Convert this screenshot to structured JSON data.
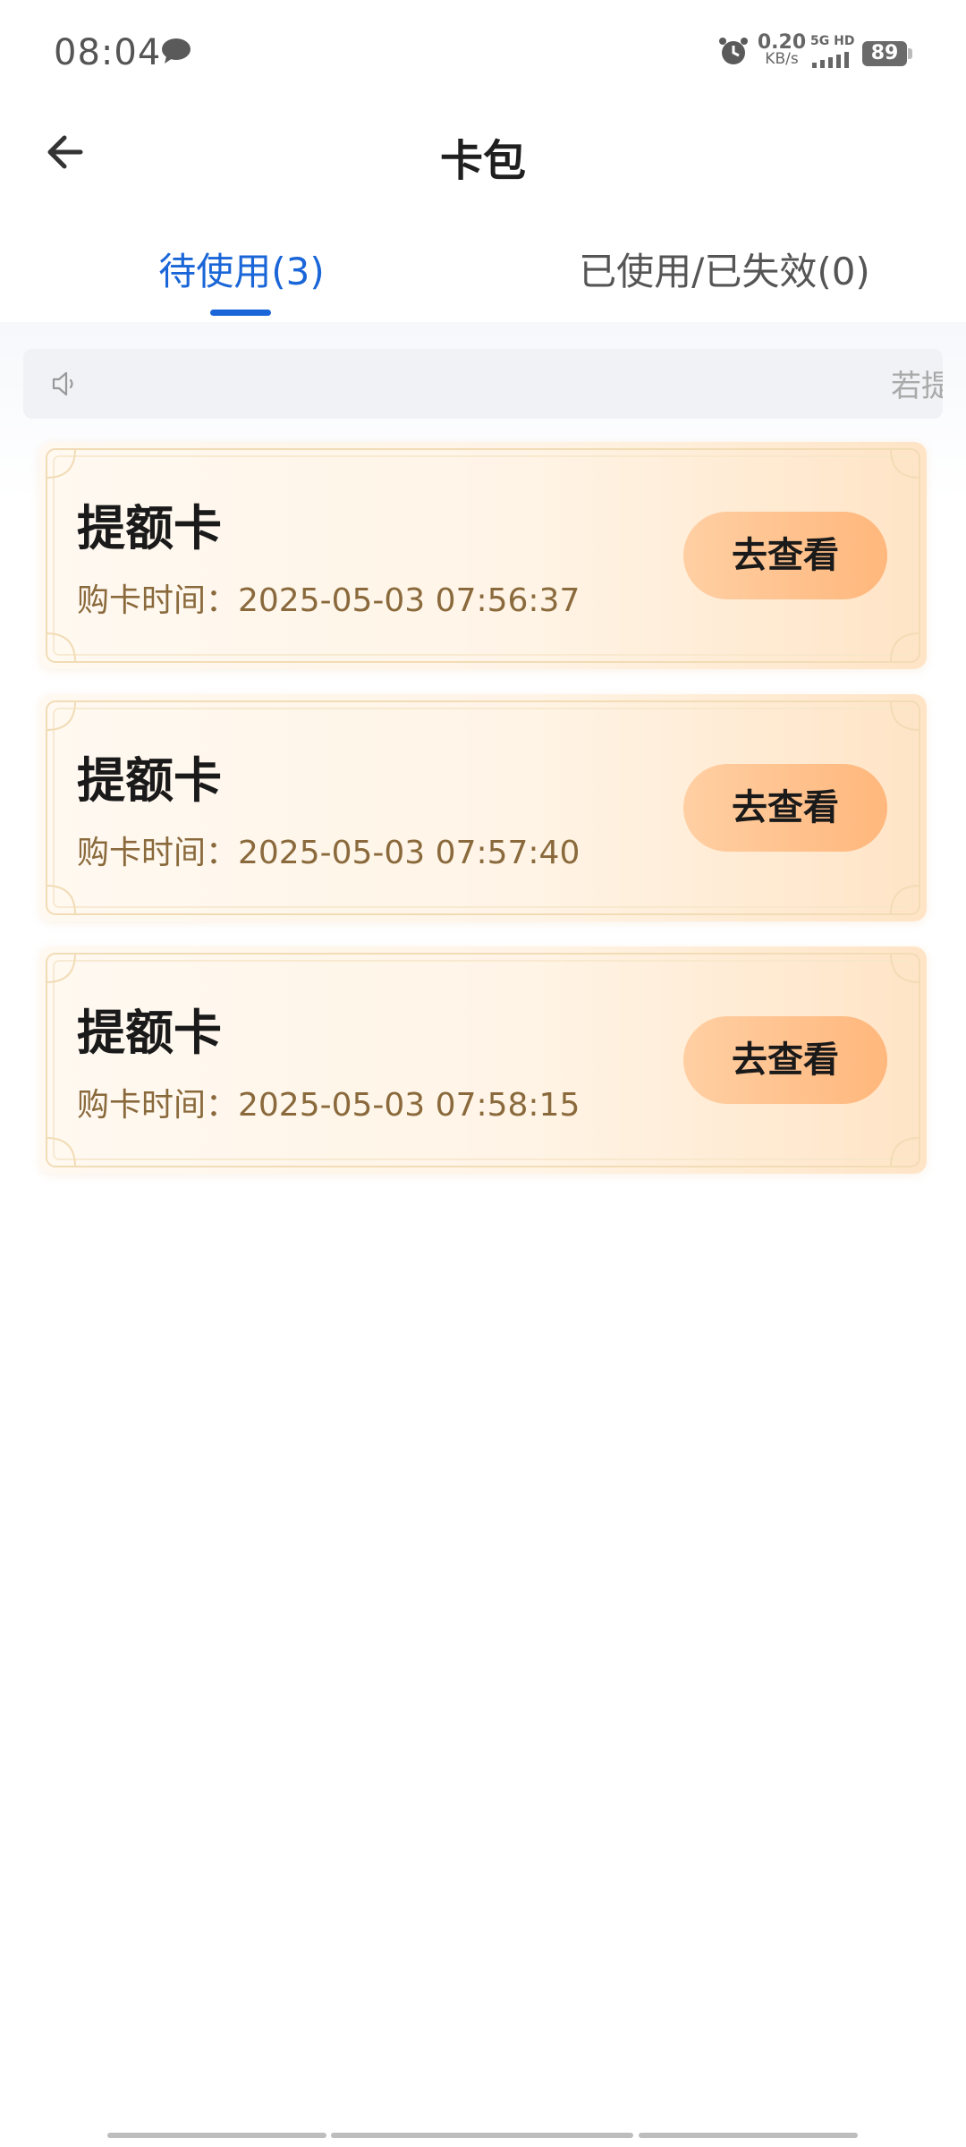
{
  "status_bar": {
    "time": "08:04",
    "net_speed_value": "0.20",
    "net_speed_unit": "KB/s",
    "net_type": "5G HD",
    "battery": "89",
    "icons": [
      "chat-bubble-icon",
      "alarm-icon",
      "signal-icon",
      "battery-icon"
    ]
  },
  "header": {
    "title": "卡包",
    "back_icon": "arrow-left-icon"
  },
  "tabs": [
    {
      "label": "待使用(3)",
      "active": true
    },
    {
      "label": "已使用/已失效(0)",
      "active": false
    }
  ],
  "notice": {
    "icon": "speaker-icon",
    "text": "若提额"
  },
  "cards": [
    {
      "title": "提额卡",
      "time": "购卡时间：2025-05-03 07:56:37",
      "button": "去查看"
    },
    {
      "title": "提额卡",
      "time": "购卡时间：2025-05-03 07:57:40",
      "button": "去查看"
    },
    {
      "title": "提额卡",
      "time": "购卡时间：2025-05-03 07:58:15",
      "button": "去查看"
    }
  ],
  "colors": {
    "accent": "#1a66d8",
    "card_button": "#ffb77c",
    "card_time_text": "#8a6a3c"
  }
}
